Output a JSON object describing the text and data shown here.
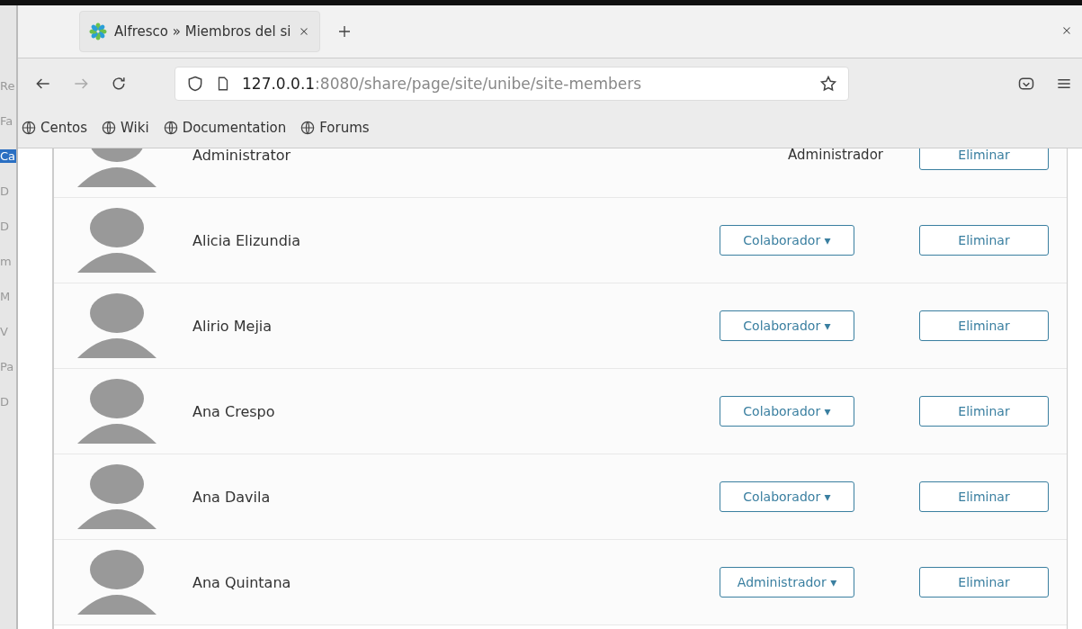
{
  "background_window": {
    "items": [
      {
        "label": "Re",
        "selected": false
      },
      {
        "label": "Fa",
        "selected": false
      },
      {
        "label": "Ca",
        "selected": true
      },
      {
        "label": "D",
        "selected": false
      },
      {
        "label": "D",
        "selected": false
      },
      {
        "label": "m",
        "selected": false
      },
      {
        "label": "M",
        "selected": false
      },
      {
        "label": "V",
        "selected": false
      },
      {
        "label": "Pa",
        "selected": false
      },
      {
        "label": "D",
        "selected": false
      }
    ]
  },
  "tabs": [
    {
      "title": "Alfresco » Miembros del si",
      "selected": true
    }
  ],
  "address_bar": {
    "host": "127.0.0.1",
    "path": ":8080/share/page/site/unibe/site-members"
  },
  "bookmarks": [
    "Centos",
    "Wiki",
    "Documentation",
    "Forums"
  ],
  "members": [
    {
      "name": "Administrator",
      "role": {
        "kind": "text",
        "label": "Administrador"
      },
      "action": "Eliminar"
    },
    {
      "name": "Alicia Elizundia",
      "role": {
        "kind": "dropdown",
        "label": "Colaborador ▾"
      },
      "action": "Eliminar"
    },
    {
      "name": "Alirio Mejia",
      "role": {
        "kind": "dropdown",
        "label": "Colaborador ▾"
      },
      "action": "Eliminar"
    },
    {
      "name": "Ana Crespo",
      "role": {
        "kind": "dropdown",
        "label": "Colaborador ▾"
      },
      "action": "Eliminar"
    },
    {
      "name": "Ana Davila",
      "role": {
        "kind": "dropdown",
        "label": "Colaborador ▾"
      },
      "action": "Eliminar"
    },
    {
      "name": "Ana Quintana",
      "role": {
        "kind": "dropdown",
        "label": "Administrador ▾"
      },
      "action": "Eliminar"
    }
  ]
}
